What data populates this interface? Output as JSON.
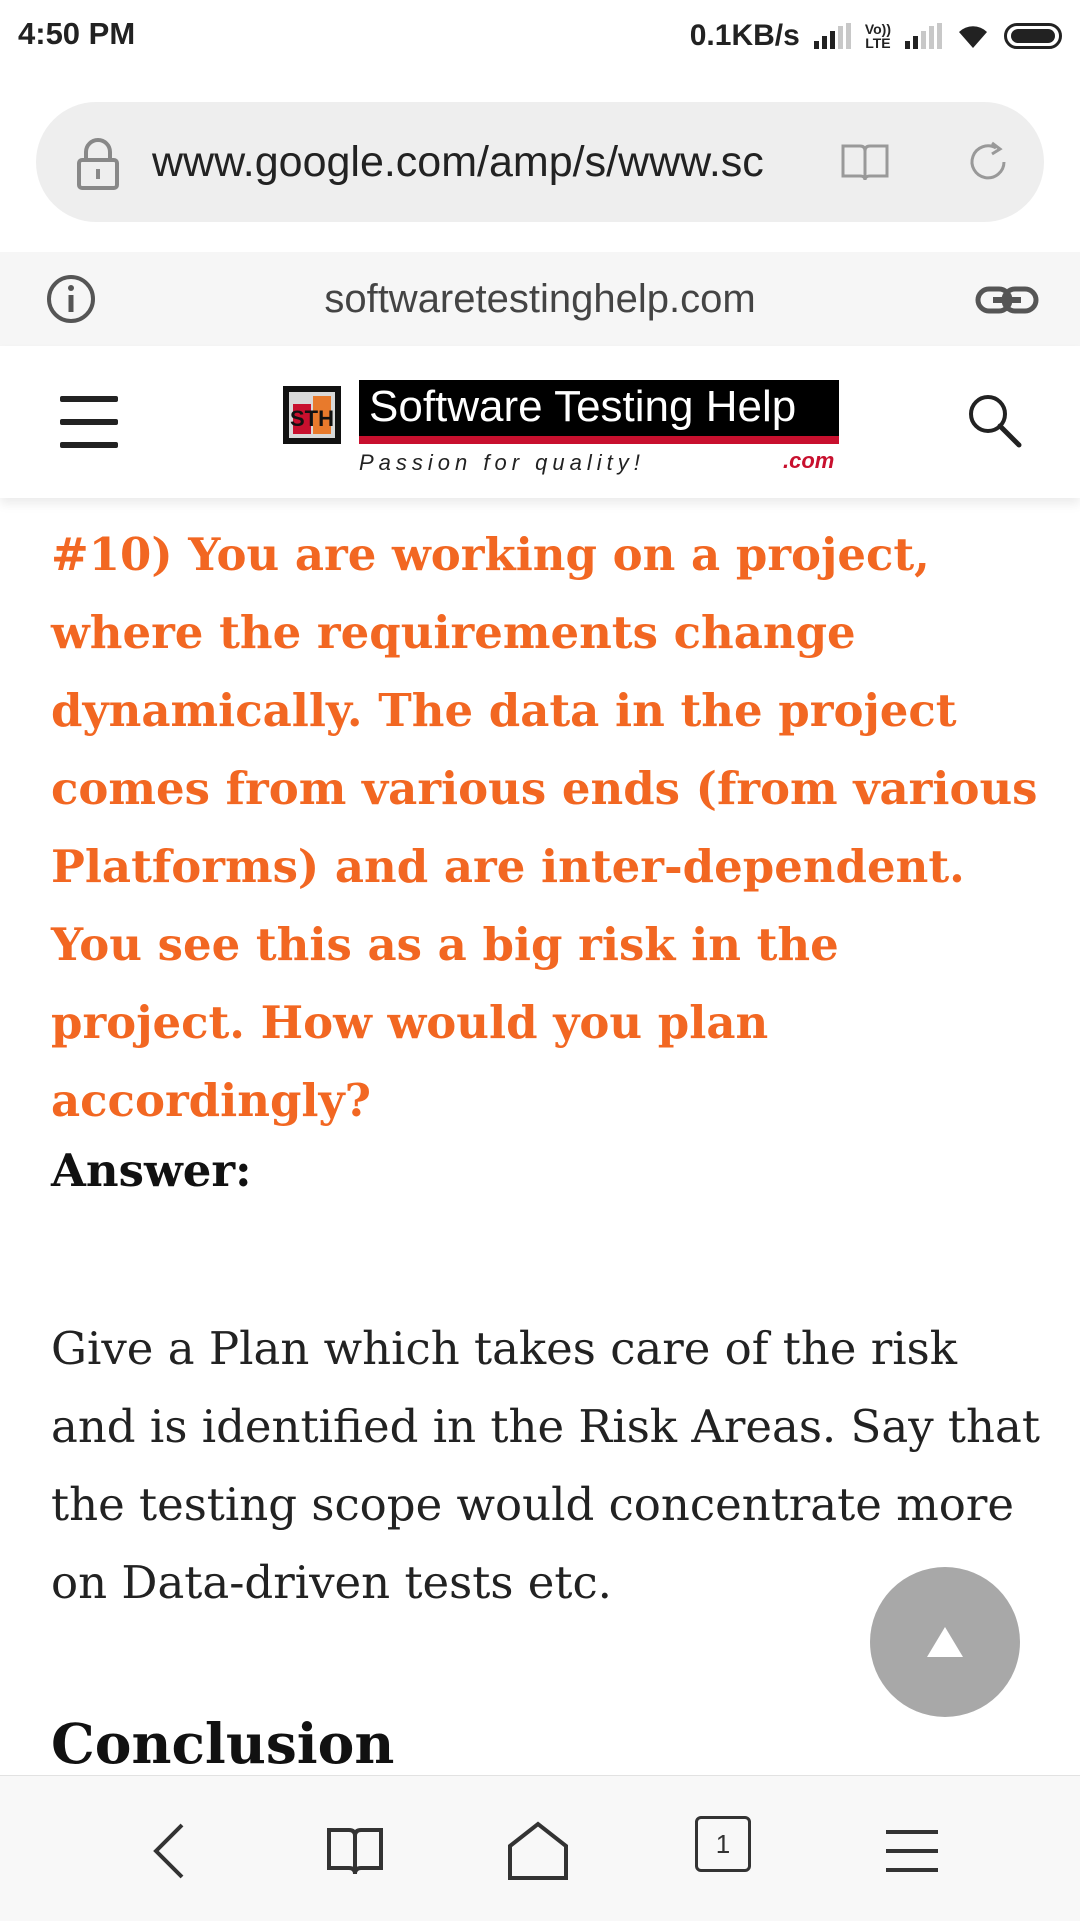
{
  "status_bar": {
    "time": "4:50 PM",
    "net_speed": "0.1KB/s",
    "volte_label": "Vo))\nLTE"
  },
  "browser": {
    "url": "www.google.com/amp/s/www.sc",
    "site_domain": "softwaretestinghelp.com",
    "open_tabs": "1"
  },
  "site_header": {
    "logo_name": "Software Testing Help",
    "logo_tagline": "Passion for quality!",
    "logo_suffix": ".com"
  },
  "article": {
    "question": "#10) You are working on a project, where the requirements change dynamically. The data in the project comes from various ends (from various Platforms) and are inter-dependent. You see this as a big risk in the project. How would you plan accordingly?",
    "answer_label": "Answer:",
    "answer_text": "Give a Plan which takes care of the risk and is identified in the Risk Areas. Say that the testing scope would concentrate more on Data-driven tests etc.",
    "next_heading": "Conclusion"
  },
  "colors": {
    "question": "#f26722",
    "logo_red": "#c8102e",
    "scroll_button": "#a8a8a8"
  },
  "icons": {
    "lock": "lock-icon",
    "reader": "reader-mode-icon",
    "reload": "reload-icon",
    "info": "info-icon",
    "link": "link-icon",
    "menu": "hamburger-menu-icon",
    "search": "search-icon",
    "scroll_top": "up-arrow-icon",
    "back": "back-icon",
    "bookmarks": "bookmarks-icon",
    "home": "home-icon",
    "tabs": "tabs-icon",
    "more": "more-menu-icon"
  }
}
